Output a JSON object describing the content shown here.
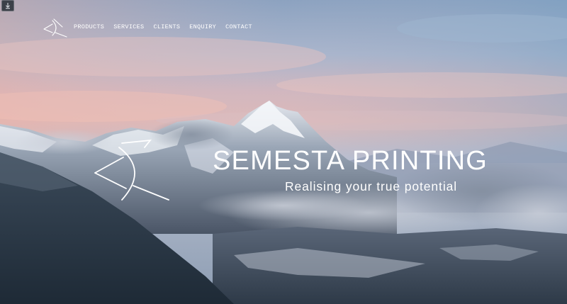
{
  "toolbar": {
    "download_icon": "download-icon"
  },
  "header": {
    "logo_icon": "semesta-logo-icon",
    "nav": [
      {
        "label": "PRODUCTS"
      },
      {
        "label": "SERVICES"
      },
      {
        "label": "CLIENTS"
      },
      {
        "label": "ENQUIRY"
      },
      {
        "label": "CONTACT"
      }
    ]
  },
  "hero": {
    "logo_icon": "semesta-logo-icon",
    "title": "SEMESTA PRINTING",
    "tagline": "Realising your true potential",
    "background": "snowy-mountain-sunrise-image"
  },
  "colors": {
    "text": "#ffffff",
    "sky_top": "#8aa7c6",
    "sky_pink": "#e8b7b1",
    "mountain_dark": "#2c3a48"
  }
}
